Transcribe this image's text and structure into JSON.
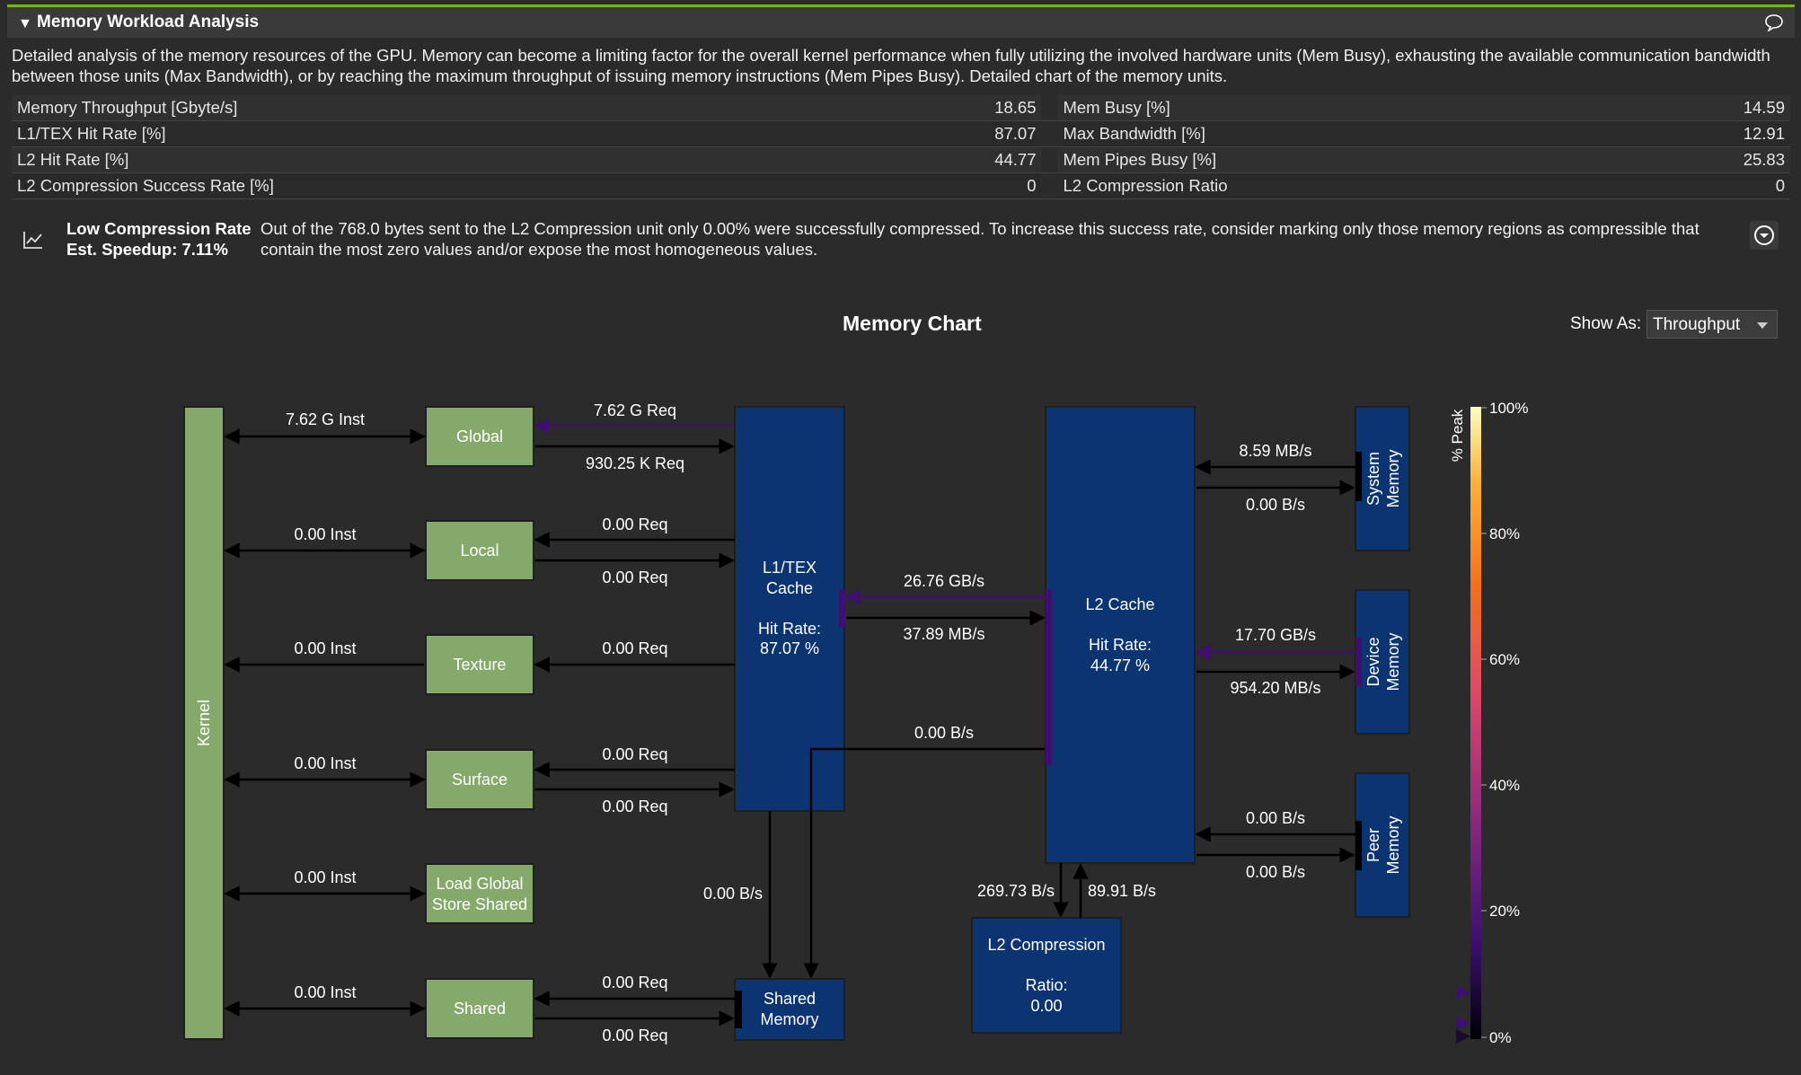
{
  "section": {
    "title": "Memory Workload Analysis",
    "description": "Detailed analysis of the memory resources of the GPU. Memory can become a limiting factor for the overall kernel performance when fully utilizing the involved hardware units (Mem Busy), exhausting the available communication bandwidth between those units (Max Bandwidth), or by reaching the maximum throughput of issuing memory instructions (Mem Pipes Busy). Detailed chart of the memory units."
  },
  "metrics": [
    {
      "left_label": "Memory Throughput [Gbyte/s]",
      "left_value": "18.65",
      "right_label": "Mem Busy [%]",
      "right_value": "14.59"
    },
    {
      "left_label": "L1/TEX Hit Rate [%]",
      "left_value": "87.07",
      "right_label": "Max Bandwidth [%]",
      "right_value": "12.91"
    },
    {
      "left_label": "L2 Hit Rate [%]",
      "left_value": "44.77",
      "right_label": "Mem Pipes Busy [%]",
      "right_value": "25.83"
    },
    {
      "left_label": "L2 Compression Success Rate [%]",
      "left_value": "0",
      "right_label": "L2 Compression Ratio",
      "right_value": "0"
    }
  ],
  "recommendation": {
    "title": "Low Compression Rate",
    "speedup": "Est. Speedup: 7.11%",
    "text": "Out of the 768.0 bytes sent to the L2 Compression unit only 0.00% were successfully compressed. To increase this success rate, consider marking only those memory regions as compressible that contain the most zero values and/or expose the most homogeneous values."
  },
  "chart": {
    "title": "Memory Chart",
    "show_as_label": "Show As:",
    "show_as_value": "Throughput",
    "nodes": {
      "kernel": "Kernel",
      "global": "Global",
      "local": "Local",
      "texture": "Texture",
      "surface": "Surface",
      "lgss_1": "Load Global",
      "lgss_2": "Store Shared",
      "shared": "Shared",
      "l1_1": "L1/TEX",
      "l1_2": "Cache",
      "l1_3": "Hit Rate:",
      "l1_4": "87.07 %",
      "shmem_1": "Shared",
      "shmem_2": "Memory",
      "l2_1": "L2 Cache",
      "l2_2": "Hit Rate:",
      "l2_3": "44.77 %",
      "l2c_1": "L2 Compression",
      "l2c_2": "Ratio:",
      "l2c_3": "0.00",
      "sys_1": "System",
      "sys_2": "Memory",
      "dev_1": "Device",
      "dev_2": "Memory",
      "peer_1": "Peer",
      "peer_2": "Memory"
    },
    "links": {
      "k_global": "7.62 G Inst",
      "k_local": "0.00 Inst",
      "k_texture": "0.00 Inst",
      "k_surface": "0.00 Inst",
      "k_lgss": "0.00 Inst",
      "k_shared": "0.00 Inst",
      "global_req_in": "7.62 G Req",
      "global_req_out": "930.25 K Req",
      "local_in": "0.00 Req",
      "local_out": "0.00 Req",
      "texture_in": "0.00 Req",
      "surface_in": "0.00 Req",
      "surface_out": "0.00 Req",
      "shared_in": "0.00 Req",
      "shared_out": "0.00 Req",
      "l1_shmem": "0.00 B/s",
      "l2_to_l1": "26.76 GB/s",
      "l1_to_l2": "37.89 MB/s",
      "l2_to_shmem": "0.00 B/s",
      "l2c_down": "269.73 B/s",
      "l2c_up": "89.91 B/s",
      "sys_in": "8.59 MB/s",
      "sys_out": "0.00 B/s",
      "dev_in": "17.70 GB/s",
      "dev_out": "954.20 MB/s",
      "peer_in": "0.00 B/s",
      "peer_out": "0.00 B/s"
    },
    "legend": {
      "title": "% Peak",
      "ticks": [
        "100%",
        "80%",
        "60%",
        "40%",
        "20%",
        "0%"
      ]
    }
  },
  "colors": {
    "accent_green": "#76b900",
    "node_green": "#85a96b",
    "node_blue": "#0b3471",
    "link_purple": "#3d0f6e"
  }
}
